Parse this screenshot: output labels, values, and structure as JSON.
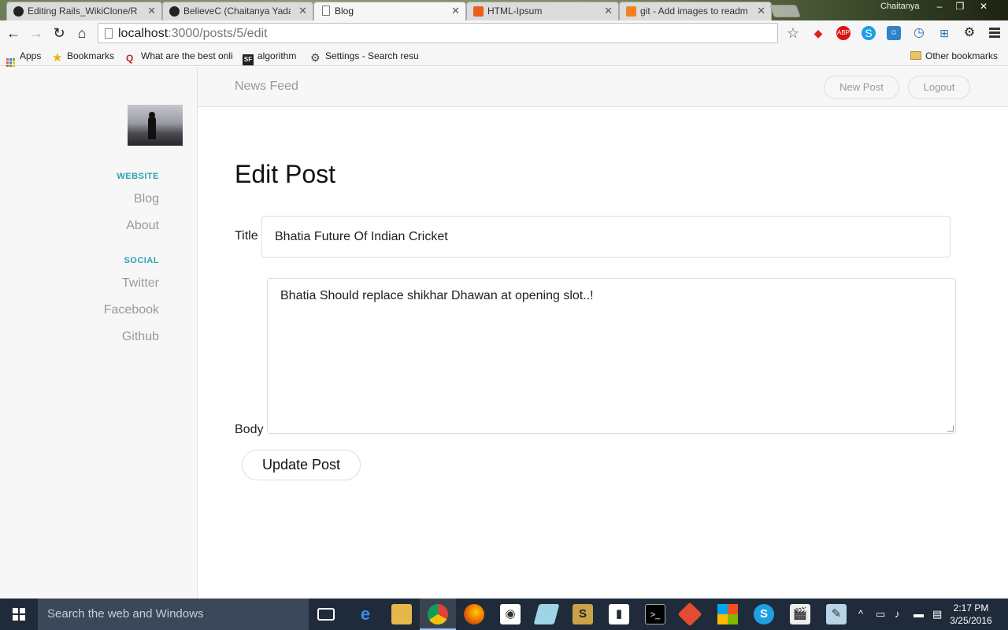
{
  "tabs": [
    {
      "label": "Editing Rails_WikiClone/R",
      "icon": "github-icon"
    },
    {
      "label": "BelieveC (Chaitanya Yadav",
      "icon": "github-icon"
    },
    {
      "label": "Blog",
      "icon": "page-icon"
    },
    {
      "label": "HTML-Ipsum",
      "icon": "html-ipsum-icon"
    },
    {
      "label": "git - Add images to readm",
      "icon": "stackoverflow-icon"
    }
  ],
  "window": {
    "user": "Chaitanya"
  },
  "address": {
    "host": "localhost",
    "path": ":3000/posts/5/edit"
  },
  "bookmarks": {
    "apps": "Apps",
    "bookmarks": "Bookmarks",
    "quora": "What are the best onli",
    "algorithm": "algorithm",
    "settings": "Settings - Search resu",
    "other": "Other bookmarks"
  },
  "nav": {
    "brand": "News Feed",
    "new_post": "New Post",
    "logout": "Logout"
  },
  "sidebar": {
    "website_heading": "WEBSITE",
    "blog": "Blog",
    "about": "About",
    "social_heading": "SOCIAL",
    "twitter": "Twitter",
    "facebook": "Facebook",
    "github": "Github"
  },
  "form": {
    "heading": "Edit Post",
    "title_label": "Title",
    "title_value": "Bhatia Future Of Indian Cricket",
    "body_label": "Body",
    "body_value": "Bhatia Should replace shikhar Dhawan at opening slot..!",
    "submit_label": "Update Post"
  },
  "taskbar": {
    "search_placeholder": "Search the web and Windows",
    "time": "2:17 PM",
    "date": "3/25/2016"
  },
  "colors": {
    "sidebar_accent": "#2aa3b0",
    "taskbar": "#1f2b3a"
  }
}
